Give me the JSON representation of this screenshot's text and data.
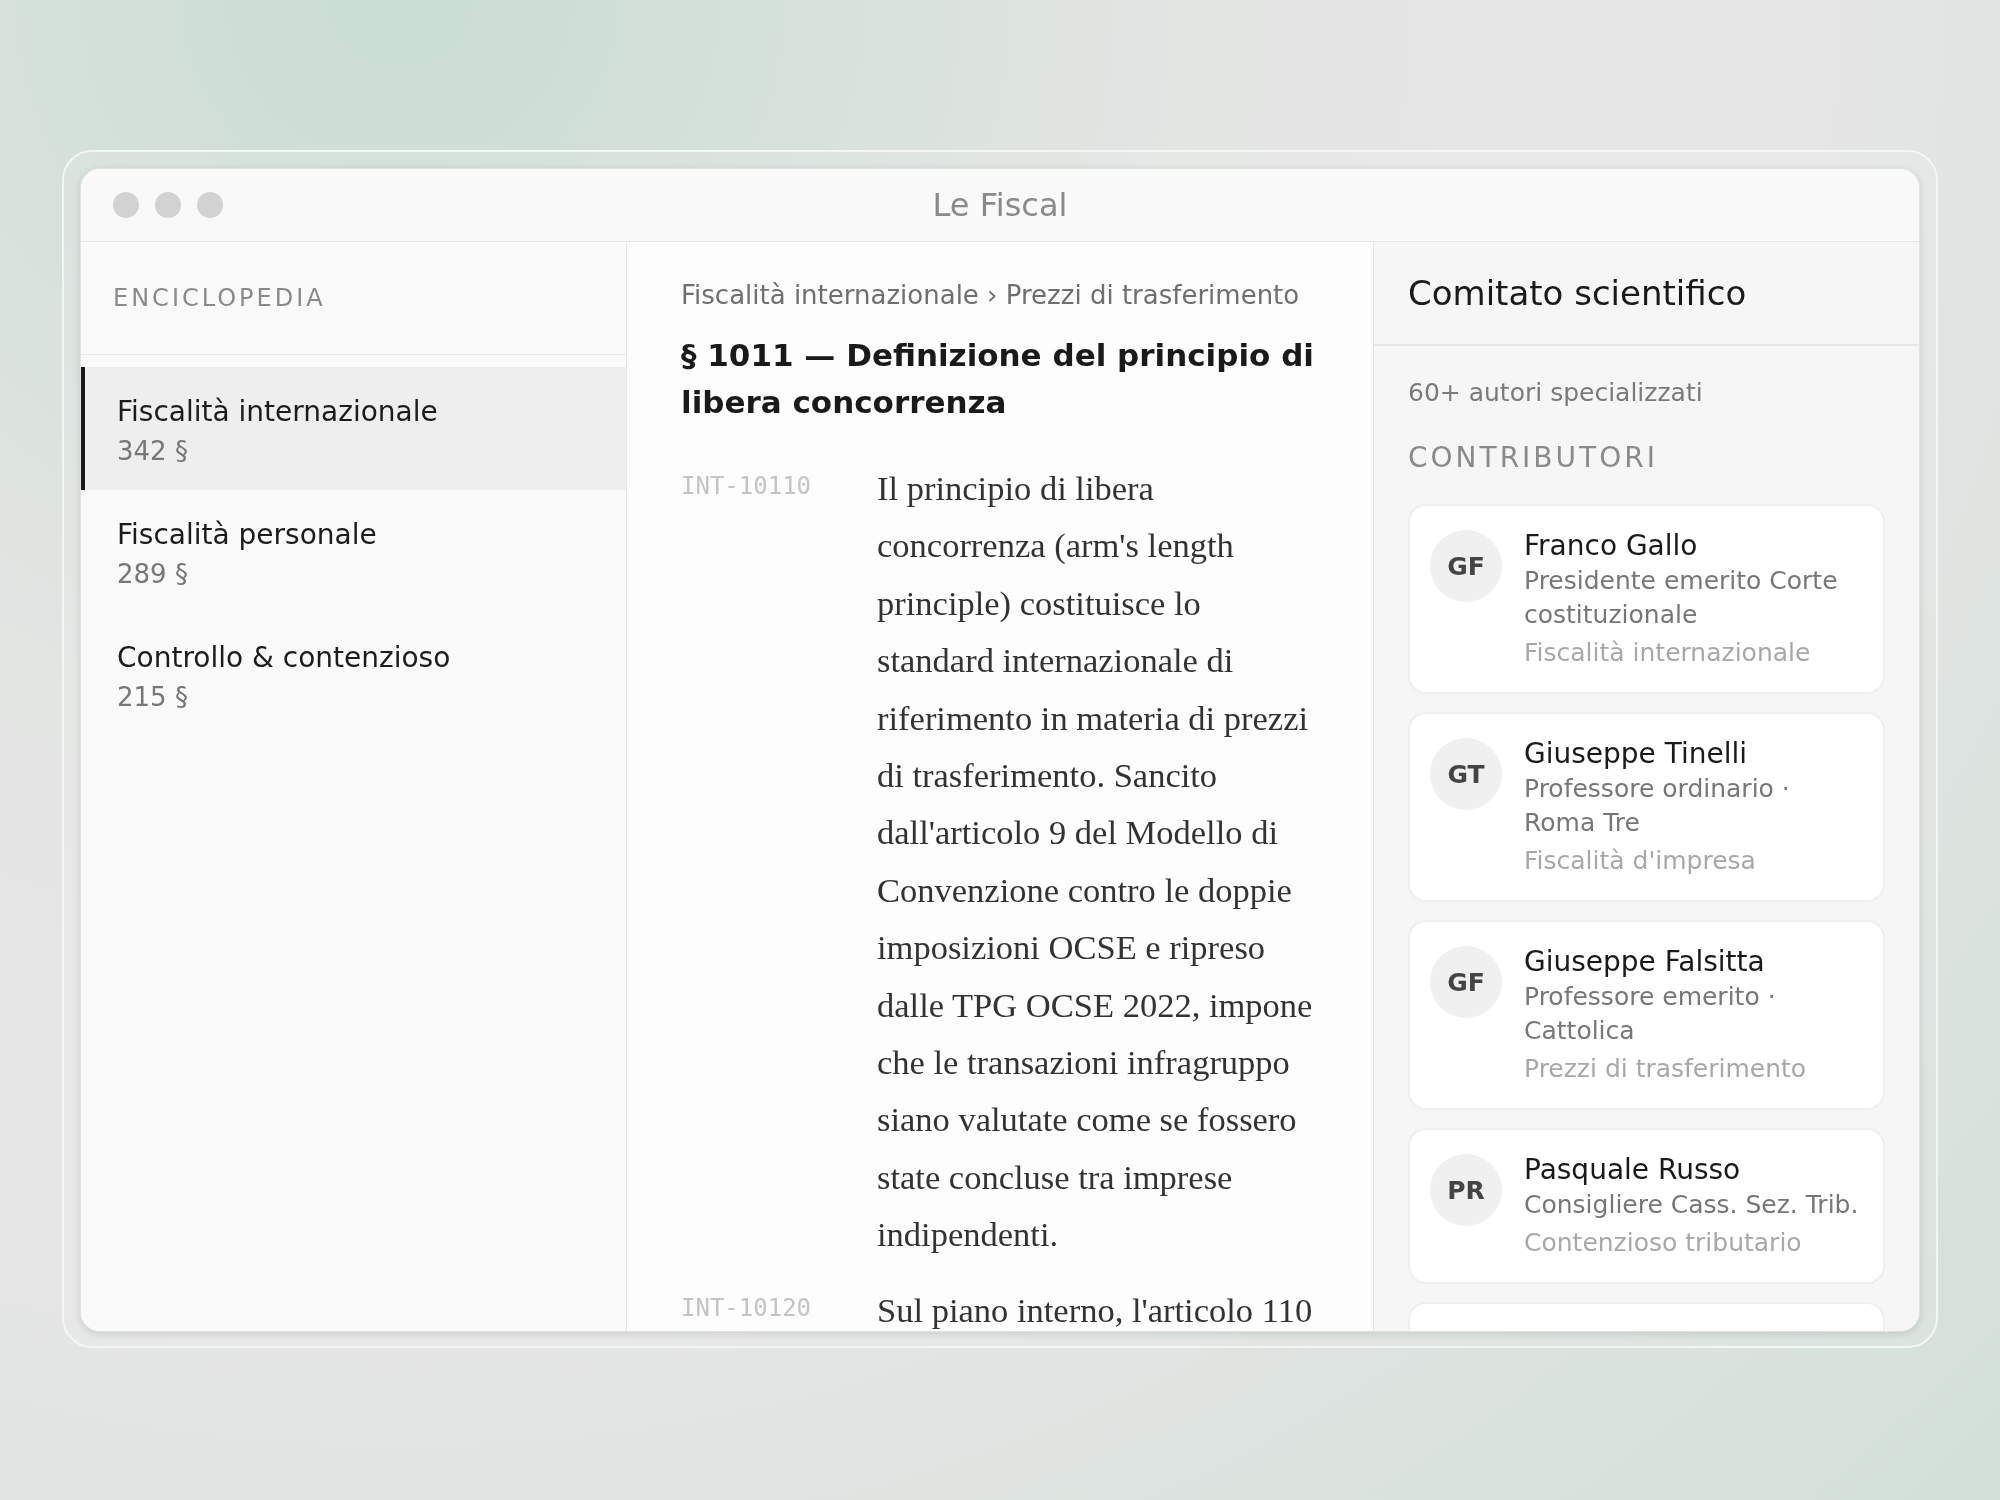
{
  "window": {
    "title": "Le Fiscal"
  },
  "sidebar": {
    "heading": "ENCICLOPEDIA",
    "items": [
      {
        "title": "Fiscalità internazionale",
        "count": "342 §",
        "selected": true
      },
      {
        "title": "Fiscalità personale",
        "count": "289 §",
        "selected": false
      },
      {
        "title": "Controllo & contenzioso",
        "count": "215 §",
        "selected": false
      }
    ]
  },
  "article": {
    "breadcrumb": "Fiscalità internazionale › Prezzi di trasferimento",
    "title": "§ 1011 — Definizione del principio di libera concorrenza",
    "paragraphs": [
      {
        "code": "INT-10110",
        "text": "Il principio di libera concorrenza (arm's length principle) costituisce lo standard internazionale di riferimento in materia di prezzi di trasferimento. Sancito dall'articolo 9 del Modello di Convenzione contro le doppie imposizioni OCSE e ripreso dalle TPG OCSE 2022, impone che le transazioni infragruppo siano valutate come se fossero state concluse tra imprese indipendenti."
      },
      {
        "code": "INT-10120",
        "text": "Sul piano interno, l'articolo 110"
      }
    ]
  },
  "panel": {
    "title": "Comitato scientifico",
    "subtitle": "60+ autori specializzati",
    "section": "CONTRIBUTORI",
    "contributors": [
      {
        "initials": "GF",
        "name": "Franco Gallo",
        "role": "Presidente emerito Corte costituzionale",
        "area": "Fiscalità internazionale"
      },
      {
        "initials": "GT",
        "name": "Giuseppe Tinelli",
        "role": "Professore ordinario · Roma Tre",
        "area": "Fiscalità d'impresa"
      },
      {
        "initials": "GF",
        "name": "Giuseppe Falsitta",
        "role": "Professore emerito · Cattolica",
        "area": "Prezzi di trasferimento"
      },
      {
        "initials": "PR",
        "name": "Pasquale Russo",
        "role": "Consigliere Cass. Sez. Trib.",
        "area": "Contenzioso tributario"
      }
    ]
  }
}
